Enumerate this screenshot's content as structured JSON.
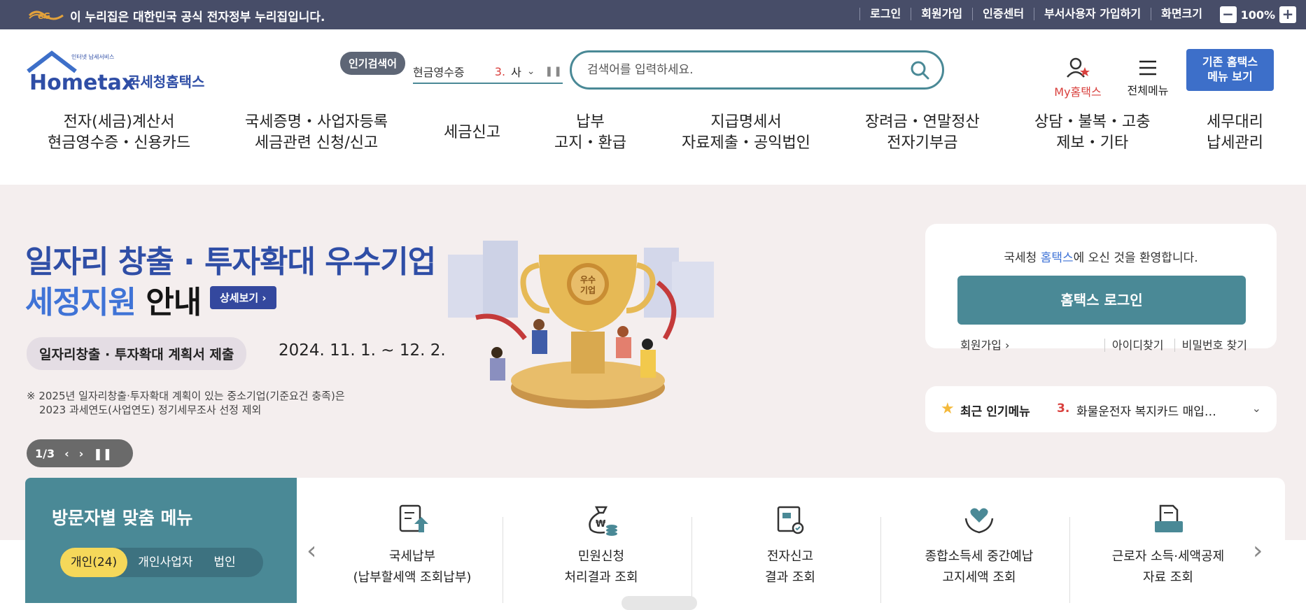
{
  "topbar": {
    "gov_notice": "이 누리집은 대한민국 공식 전자정부 누리집입니다.",
    "links": [
      "로그인",
      "회원가입",
      "인증센터",
      "부서사용자 가입하기",
      "화면크기"
    ],
    "zoom_level": "100%",
    "zoom_minus": "−",
    "zoom_plus": "+"
  },
  "header": {
    "logo_text": "Hometax",
    "logo_sub": "국세청홈택스",
    "logo_small": "인터넷 납세서비스",
    "popular_badge": "인기검색어",
    "ticker_prev": "현금영수증",
    "ticker_num": "3.",
    "ticker_text": "사",
    "search_placeholder": "검색어를 입력하세요.",
    "myhome_label": "My홈택스",
    "allmenu_label": "전체메뉴",
    "old_home_line1": "기존 홈택스",
    "old_home_line2": "메뉴 보기"
  },
  "gnb": [
    {
      "line1": "전자(세금)계산서",
      "line2": "현금영수증・신용카드"
    },
    {
      "line1": "국세증명・사업자등록",
      "line2": "세금관련 신청/신고"
    },
    {
      "line1": "세금신고",
      "line2": ""
    },
    {
      "line1": "납부",
      "line2": "고지・환급"
    },
    {
      "line1": "지급명세서",
      "line2": "자료제출・공익법인"
    },
    {
      "line1": "장려금・연말정산",
      "line2": "전자기부금"
    },
    {
      "line1": "상담・불복・고충",
      "line2": "제보・기타"
    },
    {
      "line1": "세무대리",
      "line2": "납세관리"
    }
  ],
  "hero": {
    "title_line1": "일자리 창출 · 투자확대 우수기업",
    "title_line2a": "세정지원",
    "title_line2b": " 안내",
    "detail_button": "상세보기",
    "plan_pill": "일자리창출 · 투자확대 계획서 제출",
    "plan_date": "2024. 11. 1. ~ 12. 2.",
    "notice_line1": "※ 2025년 일자리창출·투자확대 계획이 있는 중소기업(기준요건 충족)은",
    "notice_line2": "2023 과세연도(사업연도) 정기세무조사 선정 제외",
    "trophy_text": "우수기업",
    "pager": "1/3"
  },
  "login": {
    "welcome_a": "국세청 ",
    "welcome_hl": "홈택스",
    "welcome_b": "에 오신 것을 환영합니다.",
    "login_button": "홈택스 로그인",
    "join": "회원가입",
    "find_id": "아이디찾기",
    "find_pw": "비밀번호 찾기"
  },
  "popular_menu": {
    "label": "최근 인기메뉴",
    "num": "3.",
    "text": "화물운전자 복지카드 매입자료 조회"
  },
  "visitor": {
    "title": "방문자별 맞춤 메뉴",
    "tabs": [
      "개인(24)",
      "개인사업자",
      "법인"
    ],
    "items": [
      {
        "line1": "국세납부",
        "line2": "(납부할세액 조회납부)"
      },
      {
        "line1": "민원신청",
        "line2": "처리결과 조회"
      },
      {
        "line1": "전자신고",
        "line2": "결과 조회"
      },
      {
        "line1": "종합소득세 중간예납",
        "line2": "고지세액 조회"
      },
      {
        "line1": "근로자 소득·세액공제",
        "line2": "자료 조회"
      }
    ]
  },
  "colors": {
    "topbar": "#474d68",
    "teal": "#4a8996",
    "hero_bg": "#f4eeee",
    "title_blue": "#2f4ea6",
    "accent_red": "#d9413e",
    "old_home_blue": "#3d6fc9",
    "tab_active": "#f5d85a"
  }
}
